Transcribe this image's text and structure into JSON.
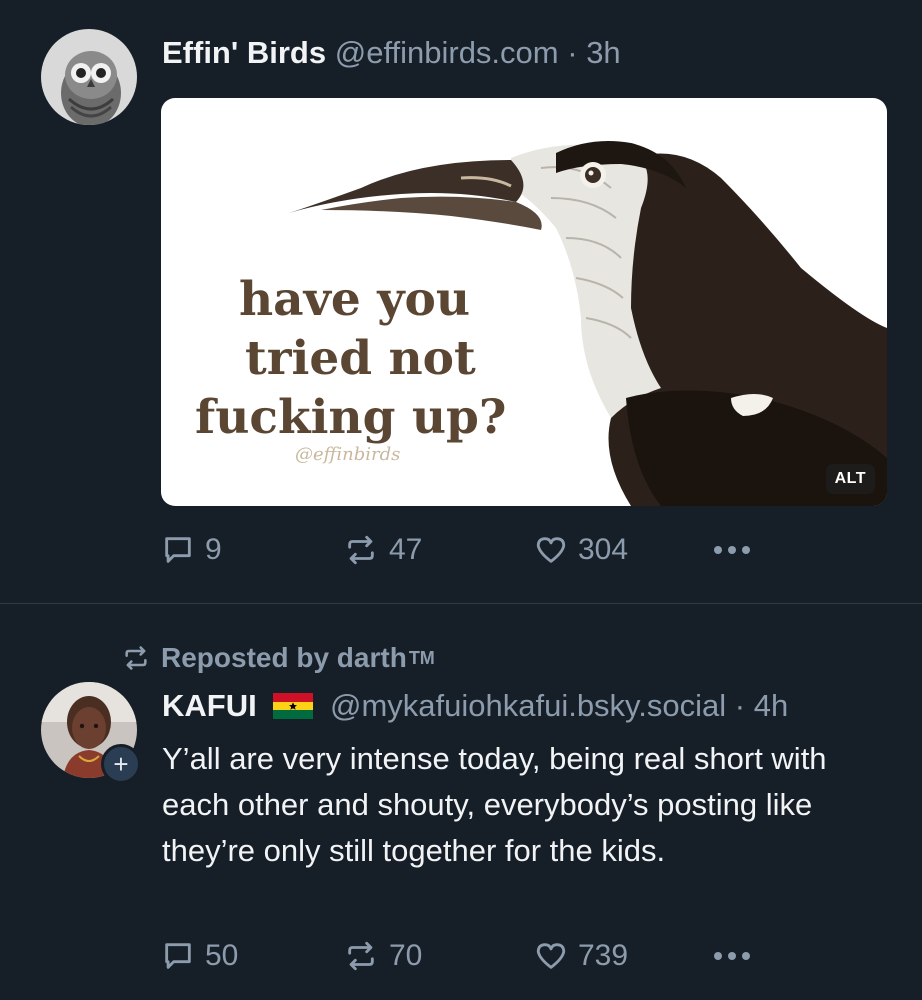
{
  "post1": {
    "author_name": "Effin' Birds",
    "handle": "@effinbirds.com",
    "separator": "·",
    "time": "3h",
    "image": {
      "caption_line1": "have you",
      "caption_line2": "tried not",
      "caption_line3": "fucking up?",
      "watermark": "@effinbirds",
      "alt_badge": "ALT"
    },
    "actions": {
      "replies": "9",
      "reposts": "47",
      "likes": "304"
    }
  },
  "post2": {
    "repost_label": "Reposted by darth",
    "repost_tm": "TM",
    "author_name": "KAFUI",
    "handle": "@mykafuiohkafui.bsky.social",
    "separator": "·",
    "time": "4h",
    "follow_symbol": "+",
    "text": "Y’all are very intense today, being real short with each other and shouty, everybody’s posting like they’re only still together for the kids.",
    "actions": {
      "replies": "50",
      "reposts": "70",
      "likes": "739"
    }
  },
  "colors": {
    "background": "#161e27",
    "muted": "#8c9cad",
    "text": "#f1f3f5",
    "divider": "#2e3a48",
    "caption": "#5a4632"
  }
}
